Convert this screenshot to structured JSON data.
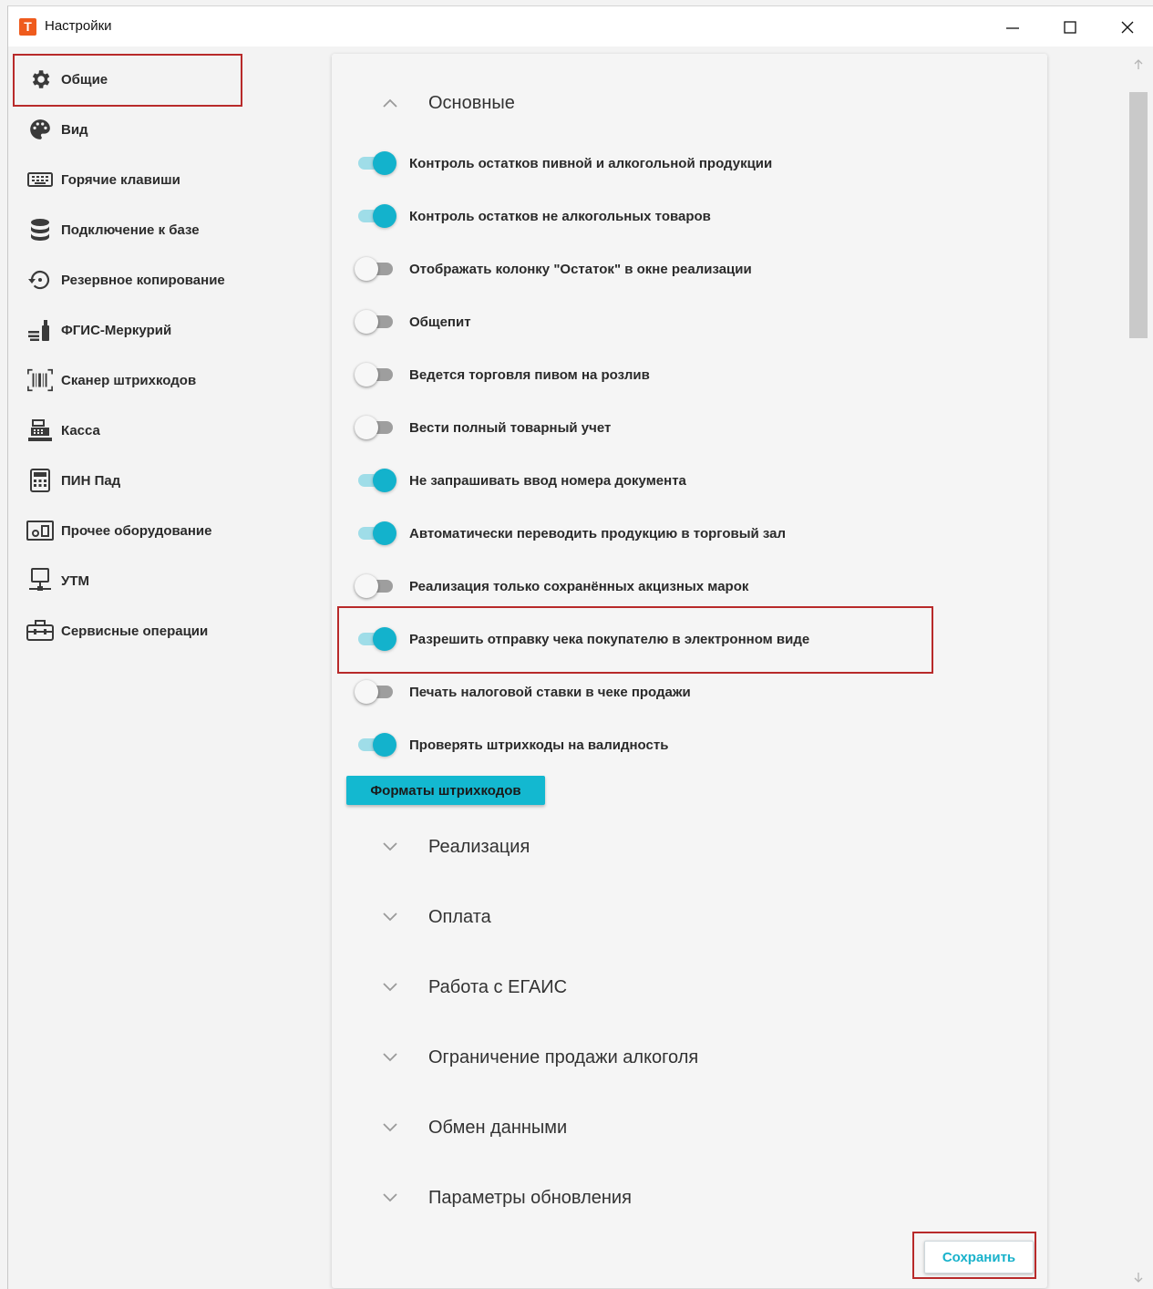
{
  "window": {
    "title": "Настройки",
    "logo_letter": "T",
    "logo_color": "#ef5b1d"
  },
  "sidebar": {
    "items": [
      {
        "label": "Общие",
        "icon": "gear-icon"
      },
      {
        "label": "Вид",
        "icon": "palette-icon"
      },
      {
        "label": "Горячие клавиши",
        "icon": "keyboard-icon"
      },
      {
        "label": "Подключение к базе",
        "icon": "database-icon"
      },
      {
        "label": "Резервное копирование",
        "icon": "backup-icon"
      },
      {
        "label": "ФГИС-Меркурий",
        "icon": "mercury-icon"
      },
      {
        "label": "Сканер штрихкодов",
        "icon": "barcode-scanner-icon"
      },
      {
        "label": "Касса",
        "icon": "cash-register-icon"
      },
      {
        "label": "ПИН Пад",
        "icon": "calculator-icon"
      },
      {
        "label": "Прочее оборудование",
        "icon": "equipment-icon"
      },
      {
        "label": "УТМ",
        "icon": "monitor-network-icon"
      },
      {
        "label": "Сервисные операции",
        "icon": "toolbox-icon"
      }
    ]
  },
  "main": {
    "expanded_section": "Основные",
    "settings": [
      {
        "label": "Контроль остатков пивной и алкогольной продукции",
        "on": true
      },
      {
        "label": "Контроль остатков не алкогольных товаров",
        "on": true
      },
      {
        "label": "Отображать колонку \"Остаток\" в окне реализации",
        "on": false
      },
      {
        "label": "Общепит",
        "on": false
      },
      {
        "label": "Ведется торговля пивом на розлив",
        "on": false
      },
      {
        "label": "Вести полный товарный учет",
        "on": false
      },
      {
        "label": "Не запрашивать ввод номера документа",
        "on": true
      },
      {
        "label": "Автоматически переводить продукцию в торговый зал",
        "on": true
      },
      {
        "label": "Реализация только сохранённых акцизных марок",
        "on": false
      },
      {
        "label": "Разрешить отправку чека покупателю в электронном виде",
        "on": true
      },
      {
        "label": "Печать налоговой ставки в чеке продажи",
        "on": false
      },
      {
        "label": "Проверять штрихкоды на валидность",
        "on": true
      }
    ],
    "barcode_formats_button": "Форматы штрихкодов",
    "collapsed_sections": [
      "Реализация",
      "Оплата",
      "Работа с ЕГАИС",
      "Ограничение продажи алкоголя",
      "Обмен данными",
      "Параметры обновления"
    ],
    "save_button": "Сохранить"
  },
  "colors": {
    "accent": "#13b2cc",
    "highlight": "#b82a2a"
  }
}
